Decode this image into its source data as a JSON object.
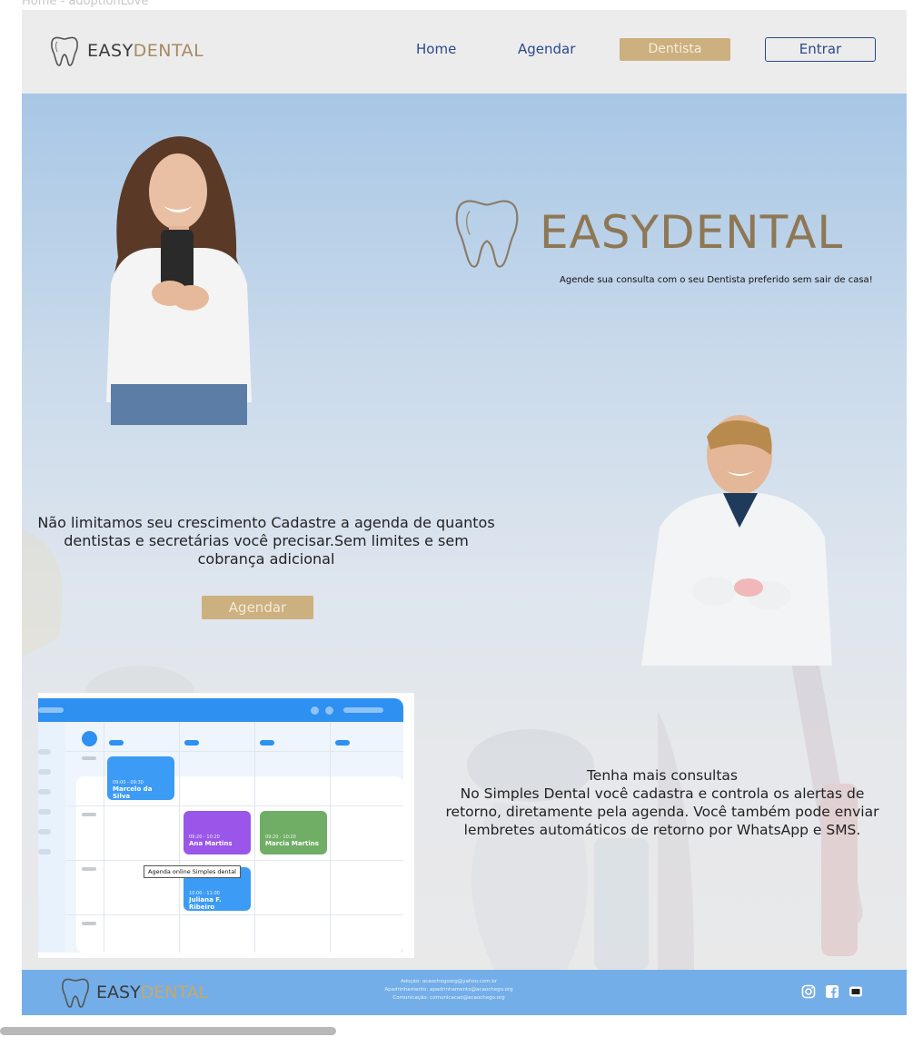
{
  "browser": {
    "title": "Home - adoptionLove"
  },
  "header": {
    "logo_prefix": "EASY",
    "logo_suffix": "DENTAL",
    "nav": {
      "home": "Home",
      "agendar": "Agendar",
      "dentista": "Dentista",
      "entrar": "Entrar"
    }
  },
  "hero": {
    "brand": "EASYDENTAL",
    "tagline": "Agende sua consulta com o seu Dentista preferido sem sair de casa!",
    "headline": "Não limitamos seu crescimento Cadastre a agenda de quantos dentistas e secretárias você precisar.Sem limites e sem cobrança adicional",
    "cta": "Agendar",
    "section2_title": "Tenha mais consultas",
    "section2_body": "No Simples Dental você cadastra e controla os alertas de retorno, diretamente pela agenda. Você também pode enviar lembretes automáticos de retorno por WhatsApp e SMS."
  },
  "calendar": {
    "tooltip": "Agenda online Simples dental",
    "appointments": [
      {
        "time": "09:00 - 09:30",
        "name": "Marcelo da Silva",
        "color": "#3c9bf5"
      },
      {
        "time": "09:20 - 10:20",
        "name": "Ana Martins",
        "color": "#9a56e8"
      },
      {
        "time": "09:20 - 10:20",
        "name": "Marcia Martins",
        "color": "#6fae64"
      },
      {
        "time": "10:00 - 11:00",
        "name": "Juliana F. Ribeiro",
        "color": "#3c9bf5"
      }
    ]
  },
  "footer": {
    "logo_prefix": "EASY",
    "logo_suffix": "DENTAL",
    "contacts": [
      "Adoção: acaochegoorg@yahoo.com.br",
      "Apadrinhamento: apadrinhamento@acaochego.org",
      "Comunicação: comunicacao@acaochego.org"
    ],
    "socials": [
      "instagram-icon",
      "facebook-icon",
      "youtube-icon"
    ]
  },
  "colors": {
    "gold": "#cdb080",
    "navy": "#2b4a8a",
    "footer": "#74aee8"
  }
}
